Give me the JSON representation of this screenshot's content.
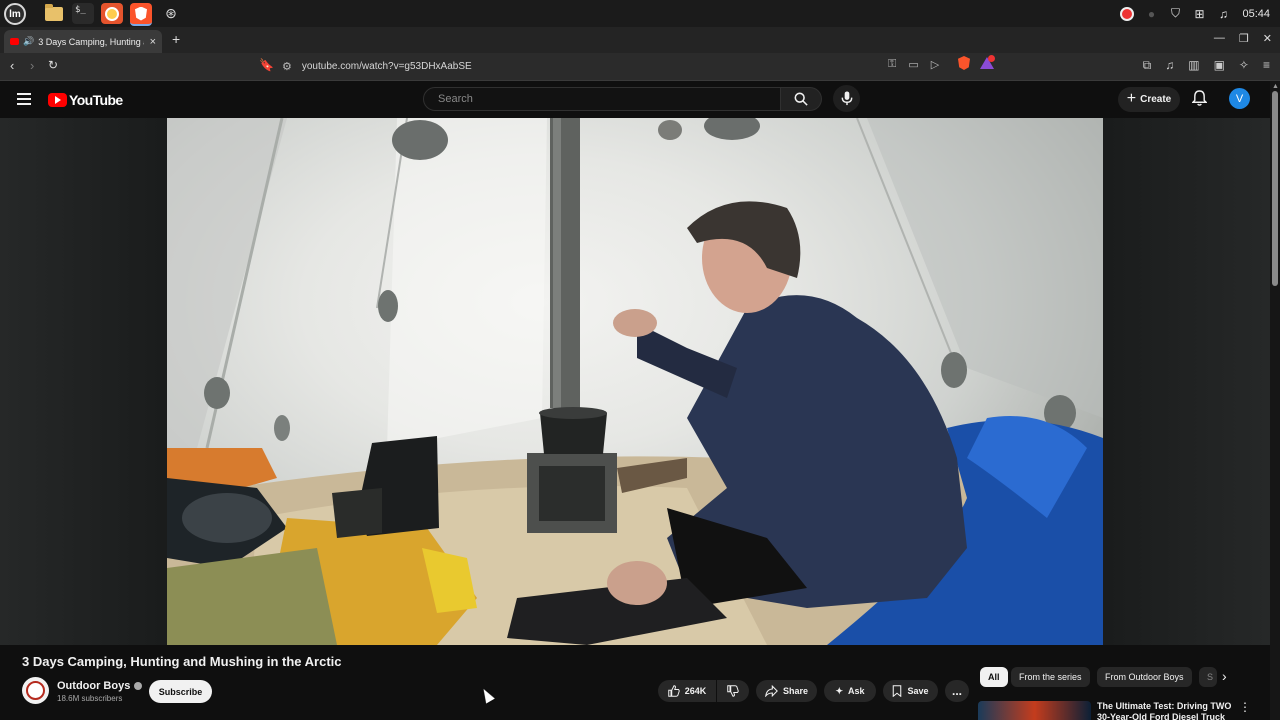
{
  "os": {
    "time": "05:44",
    "apps": [
      "mint-menu",
      "files",
      "terminal",
      "firefox",
      "brave",
      "misc"
    ]
  },
  "browser": {
    "tab_title": "3 Days Camping, Hunting and Mushing in the Arctic",
    "url": "youtube.com/watch?v=g53DHxAabSE",
    "new_tab": "+",
    "close_tab": "×",
    "shield_badge": "1"
  },
  "youtube": {
    "logo_text": "YouTube",
    "search_placeholder": "Search",
    "create_label": "Create",
    "avatar_letter": "V",
    "video": {
      "title": "3 Days Camping, Hunting and Mushing in the Arctic",
      "channel": "Outdoor Boys",
      "subscribers": "18.6M subscribers",
      "subscribe_label": "Subscribe",
      "likes": "264K",
      "share_label": "Share",
      "ask_label": "Ask",
      "save_label": "Save",
      "more_label": "..."
    },
    "chips": [
      "All",
      "From the series",
      "From Outdoor Boys",
      "S"
    ],
    "recommendation": {
      "title": "The Ultimate Test: Driving TWO 30-Year-Old Ford Diesel Truck"
    }
  },
  "colors": {
    "background": "#0f0f0f",
    "accent_red": "#ff0000",
    "avatar_blue": "#1e88e5"
  }
}
